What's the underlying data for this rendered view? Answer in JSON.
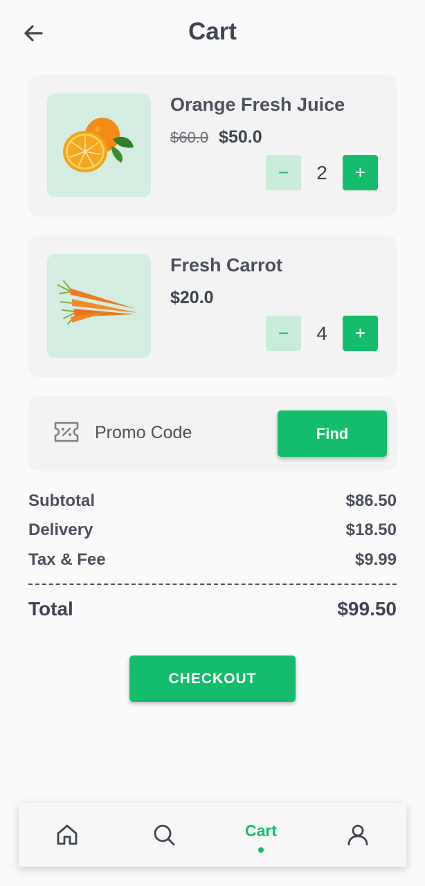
{
  "header": {
    "title": "Cart",
    "back_icon": "arrow-left-icon"
  },
  "cart_items": [
    {
      "name": "Orange Fresh Juice",
      "old_price": "$60.0",
      "price": "$50.0",
      "quantity": "2",
      "image": "orange-image"
    },
    {
      "name": "Fresh Carrot",
      "price": "$20.0",
      "quantity": "4",
      "image": "carrot-image"
    }
  ],
  "qty_controls": {
    "minus": "−",
    "plus": "+"
  },
  "promo": {
    "label": "Promo Code",
    "button": "Find",
    "icon": "coupon-icon"
  },
  "summary": {
    "subtotal_label": "Subtotal",
    "subtotal_value": "$86.50",
    "delivery_label": "Delivery",
    "delivery_value": "$18.50",
    "tax_label": "Tax & Fee",
    "tax_value": "$9.99",
    "total_label": "Total",
    "total_value": "$99.50"
  },
  "checkout": {
    "label": "CHECKOUT"
  },
  "nav": {
    "items": [
      {
        "icon": "home-icon"
      },
      {
        "icon": "search-icon"
      },
      {
        "label": "Cart",
        "active": true
      },
      {
        "icon": "user-icon"
      }
    ]
  },
  "colors": {
    "accent": "#13bd6c",
    "accent_light": "#c8ecd8",
    "thumb_bg": "#d3eee0",
    "text": "#3e4451"
  }
}
